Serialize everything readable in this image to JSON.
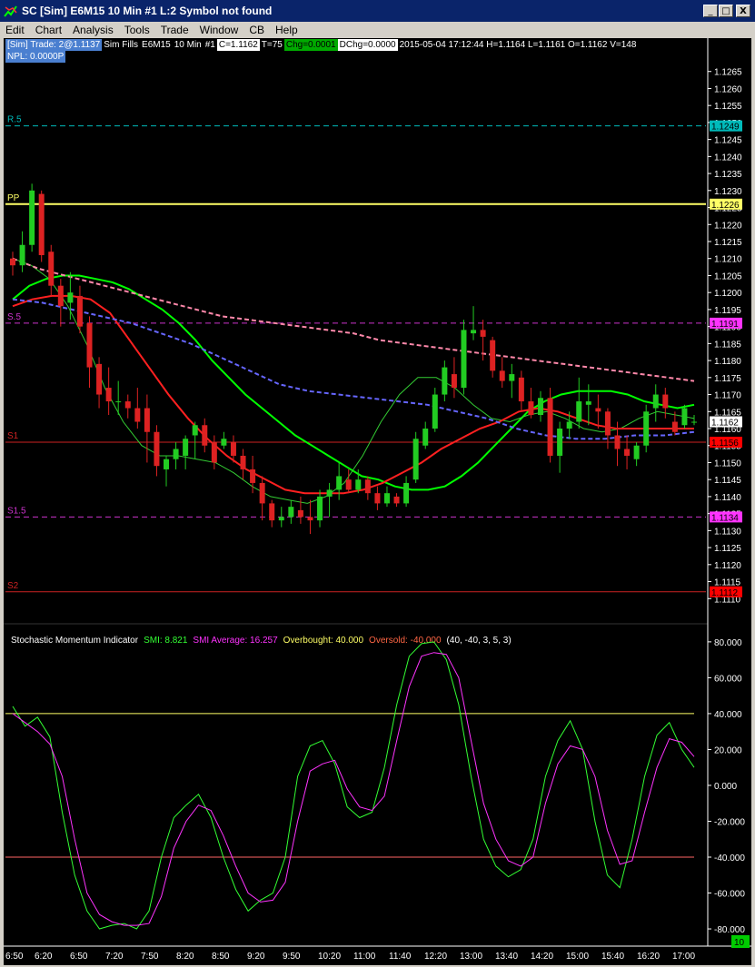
{
  "window": {
    "title": "SC [Sim] E6M15  10 Min  #1  L:2  Symbol not found",
    "buttons": [
      "_",
      "□",
      "X"
    ]
  },
  "menu": [
    "Edit",
    "Chart",
    "Analysis",
    "Tools",
    "Trade",
    "Window",
    "CB",
    "Help"
  ],
  "infobar": {
    "sim_trade": "[Sim]  Trade: 2@1.1137",
    "sim_fills": "Sim Fills",
    "symbol": "E6M15",
    "interval": "10 Min",
    "chart_num": "#1",
    "close": "C=1.1162",
    "trades": "T=75",
    "chg": "Chg=0.0001",
    "dchg": "DChg=0.0000",
    "bar_info": "2015-05-04 17:12:44 H=1.1164 L=1.1161 O=1.1162 V=148",
    "npl": "NPL: 0.0000P"
  },
  "colors": {
    "up_candle": "#22cc22",
    "down_candle": "#dd2222",
    "ma_fast_green": "#00ff00",
    "ma_thin_green": "#33cc33",
    "ma_red": "#ff2020",
    "ma_pink_dashed": "#ff88aa",
    "ma_blue_dashed": "#6666ff",
    "pivot_pp": "#ffff66",
    "level_r5": "#00cccc",
    "level_s5": "#cc33cc",
    "level_s1": "#cc2222",
    "level_s2": "#ff0000",
    "smi": "#33ff33",
    "smi_avg": "#ff33ff",
    "overbought": "#ffff66",
    "oversold": "#ff6666"
  },
  "levels": [
    {
      "label": "R.5",
      "value": 1.1249,
      "tag": "1.1249",
      "color": "#00bbbb",
      "tagbg": "#00bbbb",
      "dash": true
    },
    {
      "label": "PP",
      "value": 1.1226,
      "tag": "1.1226",
      "color": "#ffff66",
      "tagbg": "#ffff66",
      "dash": false
    },
    {
      "label": "S.5",
      "value": 1.1191,
      "tag": "1.1191",
      "color": "#cc33cc",
      "tagbg": "#ff33ff",
      "dash": true
    },
    {
      "label": "S1",
      "value": 1.1156,
      "tag": "1.1156",
      "color": "#cc2222",
      "tagbg": "#ff0000",
      "dash": false
    },
    {
      "label": "S1.5",
      "value": 1.1134,
      "tag": "1.1134",
      "color": "#cc33cc",
      "tagbg": "#ff33ff",
      "dash": true
    },
    {
      "label": "S2",
      "value": 1.1112,
      "tag": "1.1112",
      "color": "#cc2222",
      "tagbg": "#ff0000",
      "dash": false
    }
  ],
  "current_price_tag": "1.1162",
  "chart_data": [
    {
      "type": "candlestick",
      "title": "",
      "xlabel": "",
      "ylabel": "",
      "ylim": [
        1.1105,
        1.127
      ],
      "x_tick_labels": [
        "6:50",
        "6:20",
        "6:50",
        "7:20",
        "7:50",
        "8:20",
        "8:50",
        "9:20",
        "9:50",
        "10:20",
        "11:00",
        "11:40",
        "12:20",
        "13:00",
        "13:40",
        "14:20",
        "15:00",
        "15:40",
        "16:20",
        "17:00"
      ],
      "y_tick_labels": [
        "1.1265",
        "1.1260",
        "1.1255",
        "1.1250",
        "1.1245",
        "1.1240",
        "1.1235",
        "1.1230",
        "1.1225",
        "1.1220",
        "1.1215",
        "1.1210",
        "1.1205",
        "1.1200",
        "1.1195",
        "1.1190",
        "1.1185",
        "1.1180",
        "1.1175",
        "1.1170",
        "1.1165",
        "1.1160",
        "1.1155",
        "1.1150",
        "1.1145",
        "1.1140",
        "1.1135",
        "1.1130",
        "1.1125",
        "1.1120",
        "1.1115",
        "1.1110"
      ],
      "candles": [
        [
          1.121,
          1.1212,
          1.1205,
          1.1208
        ],
        [
          1.1208,
          1.1218,
          1.1206,
          1.1214
        ],
        [
          1.1214,
          1.1232,
          1.1212,
          1.123
        ],
        [
          1.1229,
          1.123,
          1.1209,
          1.1211
        ],
        [
          1.1212,
          1.1214,
          1.1199,
          1.1202
        ],
        [
          1.1202,
          1.1204,
          1.119,
          1.1196
        ],
        [
          1.1197,
          1.1206,
          1.1192,
          1.12
        ],
        [
          1.1199,
          1.1202,
          1.1188,
          1.119
        ],
        [
          1.1191,
          1.1193,
          1.1172,
          1.1178
        ],
        [
          1.1179,
          1.1181,
          1.1166,
          1.117
        ],
        [
          1.1172,
          1.1178,
          1.1164,
          1.1168
        ],
        [
          1.1168,
          1.1174,
          1.1164,
          1.1168
        ],
        [
          1.1168,
          1.117,
          1.1163,
          1.1166
        ],
        [
          1.1166,
          1.1172,
          1.116,
          1.1162
        ],
        [
          1.1166,
          1.117,
          1.115,
          1.1159
        ],
        [
          1.1159,
          1.1161,
          1.1146,
          1.1149
        ],
        [
          1.1148,
          1.1152,
          1.1143,
          1.1151
        ],
        [
          1.1151,
          1.1156,
          1.1148,
          1.1154
        ],
        [
          1.1152,
          1.1158,
          1.1148,
          1.1157
        ],
        [
          1.1158,
          1.1162,
          1.1151,
          1.1161
        ],
        [
          1.1161,
          1.1163,
          1.1153,
          1.1155
        ],
        [
          1.1156,
          1.1158,
          1.1148,
          1.115
        ],
        [
          1.1155,
          1.1159,
          1.1154,
          1.1157
        ],
        [
          1.1156,
          1.1158,
          1.115,
          1.1152
        ],
        [
          1.1152,
          1.1154,
          1.1145,
          1.1148
        ],
        [
          1.1148,
          1.1152,
          1.1141,
          1.1144
        ],
        [
          1.1144,
          1.1146,
          1.1133,
          1.1138
        ],
        [
          1.1138,
          1.1139,
          1.1131,
          1.1133
        ],
        [
          1.1133,
          1.1137,
          1.1131,
          1.1134
        ],
        [
          1.1134,
          1.1139,
          1.1132,
          1.1137
        ],
        [
          1.1136,
          1.114,
          1.1132,
          1.1134
        ],
        [
          1.1134,
          1.1139,
          1.1129,
          1.1133
        ],
        [
          1.1133,
          1.1142,
          1.1131,
          1.114
        ],
        [
          1.114,
          1.1144,
          1.1134,
          1.1142
        ],
        [
          1.1142,
          1.115,
          1.1139,
          1.1146
        ],
        [
          1.1145,
          1.1148,
          1.1141,
          1.1142
        ],
        [
          1.1142,
          1.1148,
          1.1141,
          1.1145
        ],
        [
          1.1145,
          1.1146,
          1.1139,
          1.1141
        ],
        [
          1.1141,
          1.1143,
          1.1136,
          1.1138
        ],
        [
          1.1138,
          1.1143,
          1.1137,
          1.1141
        ],
        [
          1.114,
          1.1141,
          1.1137,
          1.1138
        ],
        [
          1.1138,
          1.1146,
          1.1137,
          1.1144
        ],
        [
          1.1145,
          1.1159,
          1.1144,
          1.1157
        ],
        [
          1.1155,
          1.1162,
          1.1154,
          1.116
        ],
        [
          1.116,
          1.1172,
          1.1159,
          1.117
        ],
        [
          1.117,
          1.118,
          1.1168,
          1.1178
        ],
        [
          1.1176,
          1.1181,
          1.1169,
          1.1172
        ],
        [
          1.1172,
          1.1192,
          1.117,
          1.1189
        ],
        [
          1.1188,
          1.1196,
          1.1186,
          1.1189
        ],
        [
          1.1189,
          1.1192,
          1.118,
          1.1187
        ],
        [
          1.1186,
          1.1187,
          1.1175,
          1.1177
        ],
        [
          1.1177,
          1.1181,
          1.1172,
          1.1174
        ],
        [
          1.1174,
          1.1179,
          1.1169,
          1.1176
        ],
        [
          1.1175,
          1.1177,
          1.1165,
          1.1168
        ],
        [
          1.1168,
          1.1172,
          1.1163,
          1.1164
        ],
        [
          1.1164,
          1.1171,
          1.1162,
          1.1169
        ],
        [
          1.1169,
          1.1172,
          1.115,
          1.1152
        ],
        [
          1.1152,
          1.1162,
          1.1147,
          1.116
        ],
        [
          1.116,
          1.1165,
          1.1157,
          1.1162
        ],
        [
          1.1162,
          1.1175,
          1.116,
          1.1168
        ],
        [
          1.1167,
          1.1173,
          1.1161,
          1.1168
        ],
        [
          1.1166,
          1.117,
          1.116,
          1.1165
        ],
        [
          1.1165,
          1.1166,
          1.1154,
          1.1158
        ],
        [
          1.1158,
          1.1162,
          1.1149,
          1.1154
        ],
        [
          1.1154,
          1.1158,
          1.1148,
          1.1152
        ],
        [
          1.1151,
          1.1156,
          1.1149,
          1.1155
        ],
        [
          1.1155,
          1.1167,
          1.1153,
          1.1165
        ],
        [
          1.1166,
          1.1173,
          1.1162,
          1.117
        ],
        [
          1.117,
          1.1172,
          1.1163,
          1.1166
        ],
        [
          1.1162,
          1.1165,
          1.1158,
          1.1159
        ],
        [
          1.1161,
          1.1167,
          1.116,
          1.1166
        ],
        [
          1.1162,
          1.1164,
          1.1161,
          1.1162
        ]
      ],
      "series": [
        {
          "name": "",
          "color": "#00ff00",
          "width": 2,
          "dash": false,
          "values": [
            1.1198,
            1.1202,
            1.1204,
            1.1205,
            1.1205,
            1.1204,
            1.1203,
            1.1201,
            1.1198,
            1.1195,
            1.1191,
            1.1186,
            1.118,
            1.1175,
            1.117,
            1.1166,
            1.1162,
            1.1158,
            1.1155,
            1.1152,
            1.1149,
            1.1146,
            1.1145,
            1.1143,
            1.1142,
            1.1142,
            1.1143,
            1.1146,
            1.115,
            1.1155,
            1.116,
            1.1165,
            1.1168,
            1.117,
            1.1171,
            1.1171,
            1.1171,
            1.117,
            1.1168,
            1.1167,
            1.1166,
            1.1167
          ]
        },
        {
          "name": "",
          "color": "#33cc33",
          "width": 1,
          "dash": false,
          "values": [
            1.121,
            1.1208,
            1.1204,
            1.1196,
            1.1185,
            1.1172,
            1.1162,
            1.1155,
            1.1152,
            1.1152,
            1.1151,
            1.115,
            1.1147,
            1.1143,
            1.114,
            1.1139,
            1.1138,
            1.114,
            1.1144,
            1.1152,
            1.1162,
            1.117,
            1.1175,
            1.1175,
            1.1172,
            1.1167,
            1.1163,
            1.1162,
            1.1164,
            1.1165,
            1.1163,
            1.116,
            1.1159,
            1.116,
            1.1163,
            1.1165,
            1.1164,
            1.1163
          ]
        },
        {
          "name": "",
          "color": "#ff2020",
          "width": 2,
          "dash": false,
          "values": [
            1.1196,
            1.1198,
            1.1199,
            1.1199,
            1.1198,
            1.1194,
            1.1186,
            1.1178,
            1.117,
            1.1163,
            1.1157,
            1.1152,
            1.1148,
            1.1145,
            1.1142,
            1.1141,
            1.1141,
            1.1141,
            1.1142,
            1.1144,
            1.1147,
            1.115,
            1.1154,
            1.1157,
            1.116,
            1.1162,
            1.1165,
            1.1166,
            1.1165,
            1.1163,
            1.1161,
            1.116,
            1.116,
            1.116,
            1.116,
            1.116
          ]
        },
        {
          "name": "",
          "color": "#ff88aa",
          "width": 2,
          "dash": true,
          "values": [
            1.121,
            1.1207,
            1.1205,
            1.1203,
            1.1201,
            1.1199,
            1.1197,
            1.1195,
            1.1193,
            1.1192,
            1.1191,
            1.119,
            1.1189,
            1.1188,
            1.1186,
            1.1185,
            1.1184,
            1.1183,
            1.1182,
            1.1181,
            1.118,
            1.1179,
            1.1178,
            1.1177,
            1.1176,
            1.1175,
            1.1174
          ]
        },
        {
          "name": "",
          "color": "#6666ff",
          "width": 2,
          "dash": true,
          "values": [
            1.1198,
            1.1197,
            1.1195,
            1.1193,
            1.1191,
            1.1188,
            1.1185,
            1.1181,
            1.1177,
            1.1173,
            1.1171,
            1.117,
            1.1169,
            1.1168,
            1.1167,
            1.1165,
            1.1163,
            1.116,
            1.1158,
            1.1157,
            1.1157,
            1.1158,
            1.1158,
            1.1159
          ]
        }
      ]
    },
    {
      "type": "line",
      "title": "Stochastic Momentum Indicator",
      "legend": [
        "SMI: 8.821",
        "SMI Average: 16.257",
        "Overbought: 40.000",
        "Oversold: -40.000",
        "(40, -40, 3, 5, 3)"
      ],
      "ylim": [
        -82,
        85
      ],
      "y_tick_labels": [
        "80.000",
        "60.000",
        "40.000",
        "20.000",
        "0.000",
        "-20.000",
        "-40.000",
        "-60.000",
        "-80.000"
      ],
      "overbought": 40.0,
      "oversold": -40.0,
      "series": [
        {
          "name": "SMI",
          "color": "#33ff33",
          "values": [
            44,
            33,
            38,
            27,
            -15,
            -50,
            -70,
            -80,
            -78,
            -77,
            -80,
            -70,
            -40,
            -18,
            -11,
            -5,
            -18,
            -40,
            -58,
            -70,
            -64,
            -60,
            -40,
            5,
            22,
            25,
            12,
            -12,
            -18,
            -15,
            10,
            45,
            72,
            79,
            80,
            70,
            45,
            5,
            -30,
            -45,
            -51,
            -47,
            -30,
            5,
            25,
            36,
            20,
            -20,
            -50,
            -57,
            -30,
            5,
            28,
            35,
            20,
            10
          ]
        },
        {
          "name": "SMI Average",
          "color": "#ff33ff",
          "values": [
            40,
            35,
            30,
            23,
            5,
            -30,
            -60,
            -72,
            -76,
            -78,
            -78,
            -77,
            -62,
            -35,
            -20,
            -11,
            -14,
            -28,
            -45,
            -60,
            -65,
            -64,
            -54,
            -20,
            8,
            12,
            14,
            -2,
            -12,
            -14,
            -6,
            25,
            55,
            72,
            74,
            73,
            60,
            25,
            -10,
            -30,
            -42,
            -45,
            -40,
            -10,
            12,
            22,
            20,
            5,
            -25,
            -44,
            -42,
            -15,
            10,
            26,
            24,
            16
          ]
        }
      ]
    }
  ]
}
